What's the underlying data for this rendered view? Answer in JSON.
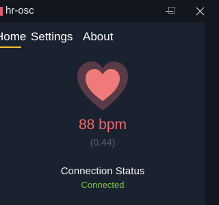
{
  "window": {
    "title": "hr-osc"
  },
  "nav": {
    "tabs": [
      {
        "label": "Home",
        "active": true
      },
      {
        "label": "Settings",
        "active": false
      },
      {
        "label": "About",
        "active": false
      }
    ]
  },
  "main": {
    "heart_rate": "88 bpm",
    "raw_value": "(0.44)",
    "status_title": "Connection Status",
    "status": "Connected"
  },
  "colors": {
    "accent": "#f1c232",
    "heart": "#f07a7a",
    "bpm_text": "#f06a6a",
    "connected": "#7dc242"
  }
}
